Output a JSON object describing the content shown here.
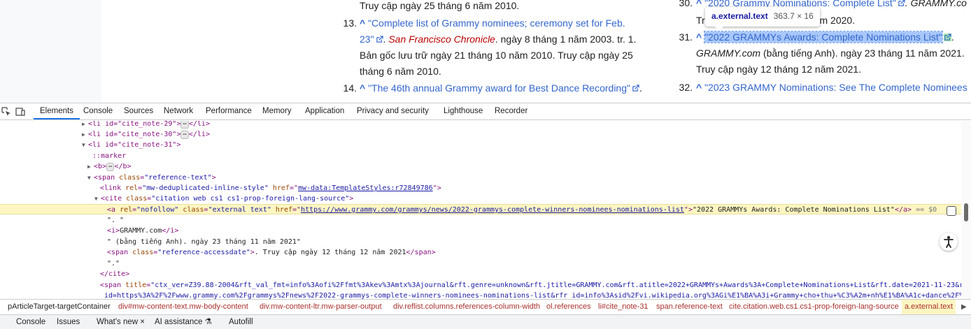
{
  "page": {
    "col1": {
      "ref12_tail": "Truy cập ngày 25 tháng 6 năm 2010.",
      "ref13": {
        "num": "13.",
        "caret": "^",
        "title_a": "\"Complete list of Grammy nominees; ceremony set for Feb.",
        "title_b": "23\"",
        "publisher": "San Francisco Chronicle",
        "rest_a": ". ngày 8 tháng 1 năm 2003. tr. 1.",
        "rest_b": "Bản gốc lưu trữ ngày 21 tháng 10 năm 2010. Truy cập ngày 25",
        "rest_c": "tháng 6 năm 2010."
      },
      "ref14": {
        "num": "14.",
        "caret": "^",
        "title": "\"The 46th annual Grammy award for Best Dance Recording\"",
        "rest": "."
      }
    },
    "col2": {
      "ref30": {
        "num": "30.",
        "caret": "^",
        "title": "\"2020 Grammy Nominations: Complete List\"",
        "rest": ". GRAMMY.co",
        "line2_a": "Tr",
        "line2_b": "ăm 2020."
      },
      "ref31": {
        "num": "31.",
        "caret": "^",
        "title": "\"2022 GRAMMYs Awards: Complete Nominations List\"",
        "rest": ".",
        "line2_site": "GRAMMY.com",
        "line2_rest": " (bằng tiếng Anh). ngày 23 tháng 11 năm 2021.",
        "line3": "Truy cập ngày 12 tháng 12 năm 2021."
      },
      "ref32": {
        "num": "32.",
        "caret": "^",
        "title": "\"2023 GRAMMY Nominations: See The Complete Nominees"
      }
    },
    "tooltip": {
      "selector": "a.external.text",
      "size": "363.7 × 16"
    }
  },
  "devtools": {
    "tabs": [
      "Elements",
      "Console",
      "Sources",
      "Network",
      "Performance",
      "Memory",
      "Application",
      "Privacy and security",
      "Lighthouse",
      "Recorder"
    ],
    "active_tab": "Elements",
    "dom": {
      "l1_open": "<li id=\"cite_note-29\">",
      "l1_close": "</li>",
      "l2_open": "<li id=\"cite_note-30\">",
      "l2_close": "</li>",
      "l3": "<li id=\"cite_note-31\">",
      "marker": "::marker",
      "b_open": "<b>",
      "b_close": "</b>",
      "span_tag": "<span",
      "span_attr": "class",
      "span_val": "\"reference-text\"",
      "link_tag": "<link",
      "link_rel_attr": "rel",
      "link_rel_val": "\"mw-deduplicated-inline-style\"",
      "link_href_attr": "href",
      "link_href_val": "mw-data:TemplateStyles:r72849786",
      "cite_tag": "<cite",
      "cite_attr": "class",
      "cite_val": "\"citation web cs1 cs1-prop-foreign-lang-source\"",
      "a_tag": "<a",
      "a_rel_attr": "rel",
      "a_rel_val": "\"nofollow\"",
      "a_class_attr": "class",
      "a_class_val": "\"external text\"",
      "a_href_attr": "href",
      "a_href_val": "https://www.grammy.com/grammys/news/2022-grammys-complete-winners-nominees-nominations-list",
      "a_text": "\"2022 GRAMMYs Awards: Complete Nominations List\"",
      "a_close": "</a>",
      "a_eq": "== $0",
      "t1": "\". \"",
      "i_open": "<i>",
      "i_text": "GRAMMY.com",
      "i_close": "</i>",
      "t2": "\" (bằng tiếng Anh). ngày 23 tháng 11 năm 2021\"",
      "span2_tag": "<span",
      "span2_attr": "class",
      "span2_val": "\"reference-accessdate\"",
      "span2_text": ". Truy cập ngày 12 tháng 12 năm 2021",
      "span2_close": "</span>",
      "t3": "\".\"",
      "cite_close": "</cite>",
      "span3_tag": "<span",
      "span3_attr": "title",
      "span3_val_a": "\"ctx_ver=Z39.88-2004&rft_val_fmt=info%3Aofi%2Ffmt%3Akev%3Amtx%3Ajournal&rft.genre=unknown&rft.jtitle=GRAMMY.com&rft.atitle=2022+GRAMMYs+Awards%3A+Complete+Nominations+List&rft.date=2021-11-23&rft",
      "span3_val_b": "_id=https%3A%2F%2Fwww.grammy.com%2Fgrammys%2Fnews%2F2022-grammys-complete-winners-nominees-nominations-list&rfr_id=info%3Asid%2Fvi.wikipedia.org%3AGi%E1%BA%A3i+Grammy+cho+thu+%C3%A2m+nh%E1%BA%A1c+dance%2F%C"
    },
    "breadcrumbs": [
      "pArticleTarget-targetContainer",
      "div#mw-content-text.mw-body-content",
      "div.mw-content-ltr.mw-parser-output",
      "div.reflist.columns.references-column-width",
      "ol.references",
      "li#cite_note-31",
      "span.reference-text",
      "cite.citation.web.cs1.cs1-prop-foreign-lang-source",
      "a.external.text"
    ],
    "drawer_tabs": [
      "Console",
      "Issues",
      "What's new",
      "AI assistance",
      "Autofill"
    ],
    "drawer_close": "×",
    "colors": {
      "accent": "#1a73e8",
      "selected_row": "#fdf6c2",
      "tag": "#881280",
      "attr_name": "#994500",
      "attr_value": "#1a1aa6"
    },
    "icons": [
      "inspect-icon",
      "device-toolbar-icon",
      "accessibility-icon",
      "edit-html-icon",
      "ai-assistance-icon"
    ]
  }
}
